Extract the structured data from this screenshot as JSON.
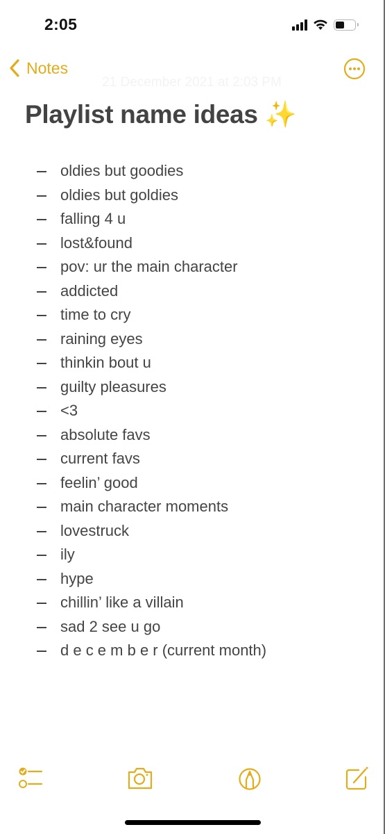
{
  "status_bar": {
    "time": "2:05",
    "icons": [
      "cellular-signal-icon",
      "wifi-icon",
      "battery-icon"
    ],
    "battery_level": 0.45
  },
  "nav": {
    "back_label": "Notes",
    "back_icon": "chevron-left-icon",
    "date": "21 December 2021 at 2:03 PM",
    "more_icon": "ellipsis-circle-icon"
  },
  "note": {
    "title": "Playlist name ideas ✨",
    "items": [
      "oldies but goodies",
      "oldies but goldies",
      "falling 4 u",
      "lost&found",
      "pov: ur the main character",
      "addicted",
      "time to cry",
      "raining eyes",
      "thinkin bout u",
      "guilty pleasures",
      "<3",
      "absolute favs",
      "current favs",
      "feelin’ good",
      "main character moments",
      "lovestruck",
      "ily",
      "hype",
      "chillin’ like a villain",
      "sad 2 see u go",
      "d e c e m b e r (current month)"
    ]
  },
  "toolbar": {
    "items": [
      "checklist-icon",
      "camera-icon",
      "markup-pen-icon",
      "compose-icon"
    ]
  },
  "colors": {
    "accent": "#e2ad1c",
    "text": "#444444",
    "title": "#434343"
  }
}
